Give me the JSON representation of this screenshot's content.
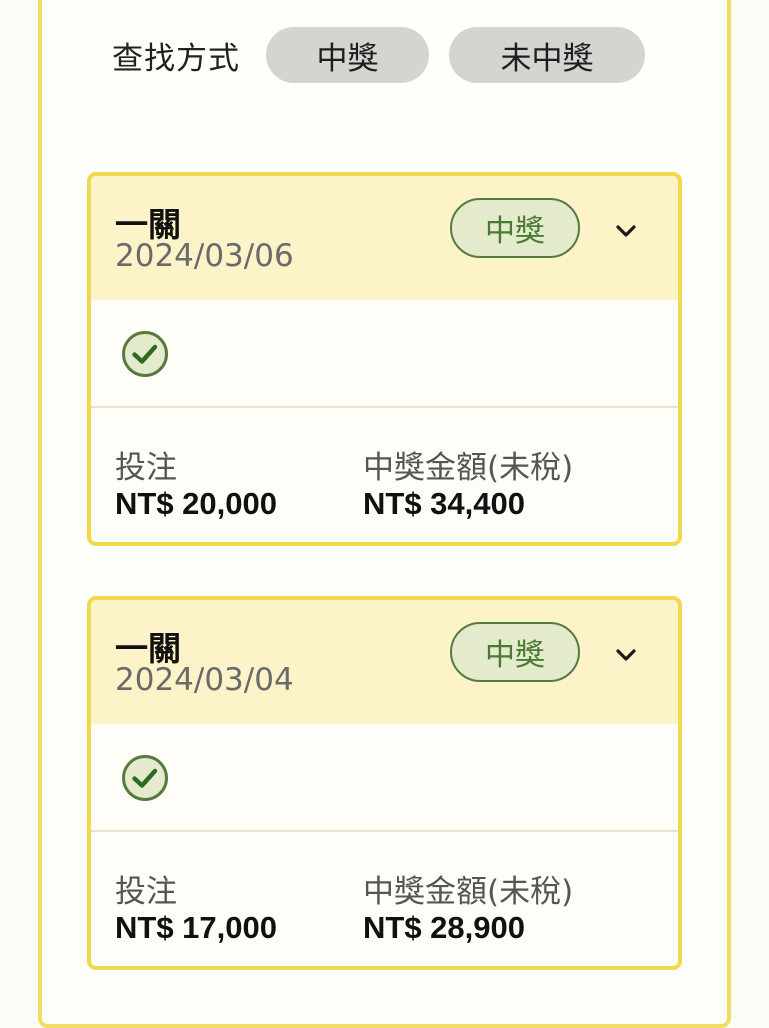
{
  "filter": {
    "label": "查找方式",
    "options": [
      "中獎",
      "未中獎"
    ]
  },
  "colors": {
    "frame": "#f2dc62",
    "card_header": "#fcf4c8",
    "win_green": "#4a7a32",
    "filter_pill": "#d4d4d0"
  },
  "records": [
    {
      "title": "一關",
      "date": "2024/03/06",
      "status": "中獎",
      "status_icon": "check-circle-icon",
      "bet_label": "投注",
      "bet_value": "NT$ 20,000",
      "prize_label": "中獎金額(未稅)",
      "prize_value": "NT$ 34,400"
    },
    {
      "title": "一關",
      "date": "2024/03/04",
      "status": "中獎",
      "status_icon": "check-circle-icon",
      "bet_label": "投注",
      "bet_value": "NT$ 17,000",
      "prize_label": "中獎金額(未稅)",
      "prize_value": "NT$ 28,900"
    }
  ]
}
